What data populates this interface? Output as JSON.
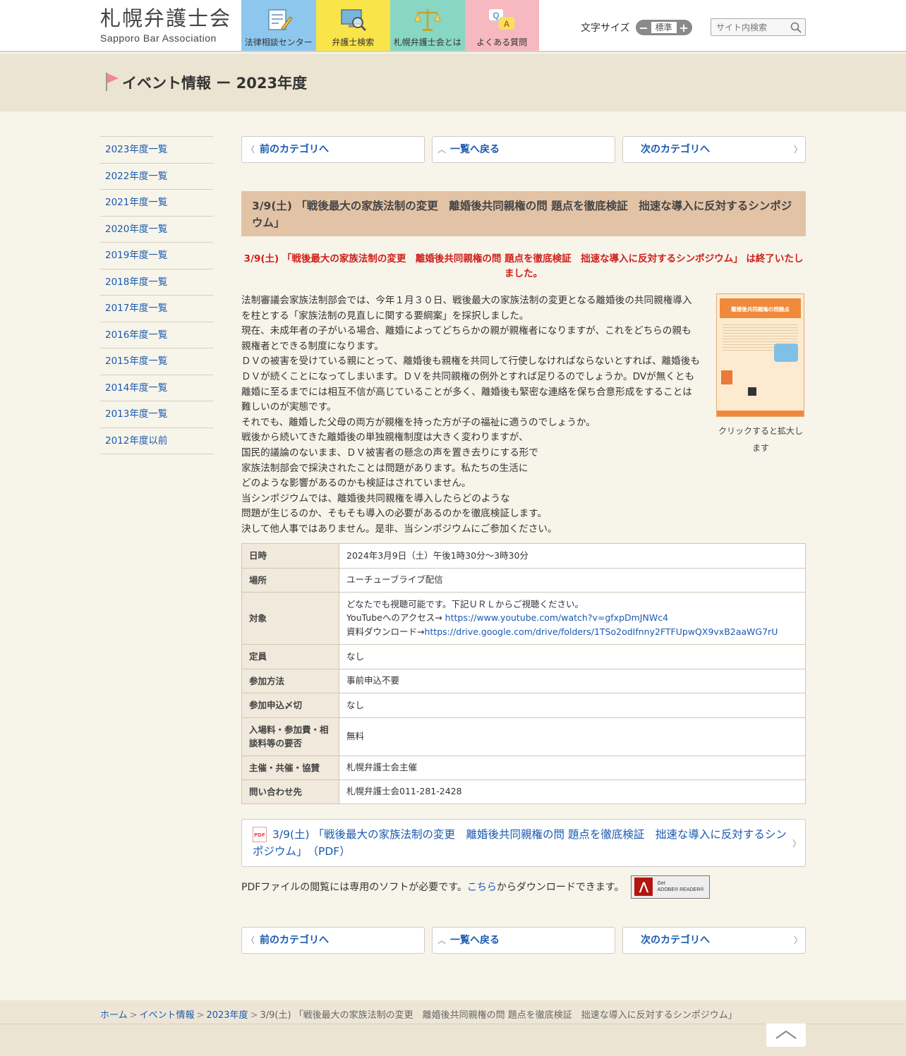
{
  "header": {
    "logo_jp": "札幌弁護士会",
    "logo_en": "Sapporo Bar Association",
    "nav": [
      {
        "label": "法律相談センター",
        "color": "#8dc7ee",
        "icon": "document-pen-icon"
      },
      {
        "label": "弁護士検索",
        "color": "#f9e44a",
        "icon": "monitor-search-icon"
      },
      {
        "label": "札幌弁護士会とは",
        "color": "#88d6c4",
        "icon": "scales-icon"
      },
      {
        "label": "よくある質問",
        "color": "#f6b9c0",
        "icon": "qa-bubble-icon"
      }
    ],
    "font_size_label": "文字サイズ",
    "font_minus": "−",
    "font_current": "標準",
    "font_plus": "+",
    "search_placeholder": "サイト内検索"
  },
  "page_title": "イベント情報 ー 2023年度",
  "sidebar": {
    "items": [
      "2023年度一覧",
      "2022年度一覧",
      "2021年度一覧",
      "2020年度一覧",
      "2019年度一覧",
      "2018年度一覧",
      "2017年度一覧",
      "2016年度一覧",
      "2015年度一覧",
      "2014年度一覧",
      "2013年度一覧",
      "2012年度以前"
    ]
  },
  "pager": {
    "prev": "前のカテゴリへ",
    "list": "一覧へ戻る",
    "next": "次のカテゴリへ"
  },
  "event": {
    "heading": "3/9(土) 「戦後最大の家族法制の変更　離婚後共同親権の問 題点を徹底検証　拙速な導入に反対するシンポジウム」",
    "ended": "3/9(土) 「戦後最大の家族法制の変更　離婚後共同親権の問 題点を徹底検証　拙速な導入に反対するシンポジウム」 は終了いたしました。",
    "body": [
      "法制審議会家族法制部会では、今年１月３０日、戦後最大の家族法制の変更となる離婚後の共同親権導入を柱とする「家族法制の見直しに関する要綱案」を採択しました。",
      "現在、未成年者の子がいる場合、離婚によってどちらかの親が親権者になりますが、これをどちらの親も親権者とできる制度になります。",
      "ＤＶの被害を受けている親にとって、離婚後も親権を共同して行使しなければならないとすれば、離婚後もＤＶが続くことになってしまいます。ＤＶを共同親権の例外とすれば足りるのでしょうか。DVが無くとも離婚に至るまでには相互不信が高じていることが多く、離婚後も緊密な連絡を保ち合意形成をすることは難しいのが実態です。",
      "それでも、離婚した父母の両方が親権を持った方が子の福祉に適うのでしょうか。",
      "戦後から続いてきた離婚後の単独親権制度は大きく変わりますが、",
      "国民的議論のないまま、ＤＶ被害者の懸念の声を置き去りにする形で",
      "家族法制部会で採決されたことは問題があります。私たちの生活に",
      "どのような影響があるのかも検証はされていません。",
      "当シンポジウムでは、離婚後共同親権を導入したらどのような",
      "問題が生じるのか、そもそも導入の必要があるのかを徹底検証します。",
      "決して他人事ではありません。是非、当シンポジウムにご参加ください。"
    ],
    "poster_title": "離婚後共同親権の問題点",
    "poster_caption": "クリックすると拡大します",
    "table": {
      "date_label": "日時",
      "date_value": "2024年3月9日（土）午後1時30分〜3時30分",
      "place_label": "場所",
      "place_value": "ユーチューブライブ配信",
      "target_label": "対象",
      "target_line1": "どなたでも視聴可能です。下記ＵＲＬからご視聴ください。",
      "target_yt_prefix": "YouTubeへのアクセス→ ",
      "target_yt_url": "https://www.youtube.com/watch?v=gfxpDmJNWc4",
      "target_dl_prefix": "資料ダウンロード→",
      "target_dl_url": "https://drive.google.com/drive/folders/1TSo2odIfnny2FTFUpwQX9vxB2aaWG7rU",
      "capacity_label": "定員",
      "capacity_value": "なし",
      "method_label": "参加方法",
      "method_value": "事前申込不要",
      "deadline_label": "参加申込〆切",
      "deadline_value": "なし",
      "fee_label": "入場料・参加費・相談料等の要否",
      "fee_value": "無料",
      "host_label": "主催・共催・協賛",
      "host_value": "札幌弁護士会主催",
      "contact_label": "問い合わせ先",
      "contact_value": "札幌弁護士会011-281-2428"
    },
    "pdf_icon": "PDF",
    "pdf_link": "3/9(土) 「戦後最大の家族法制の変更　離婚後共同親権の問 題点を徹底検証　拙速な導入に反対するシンポジウム」　（PDF）",
    "pdf_note_prefix": "PDFファイルの閲覧には専用のソフトが必要です。",
    "pdf_note_link": "こちら",
    "pdf_note_suffix": "からダウンロードできます。",
    "adobe_line1": "Get",
    "adobe_line2": "ADOBE® READER®"
  },
  "breadcrumb": {
    "home": "ホーム",
    "events": "イベント情報",
    "year": "2023年度",
    "current": "3/9(土) 「戦後最大の家族法制の変更　離婚後共同親権の問 題点を徹底検証　拙速な導入に反対するシンポジウム」",
    "sep": ">"
  }
}
